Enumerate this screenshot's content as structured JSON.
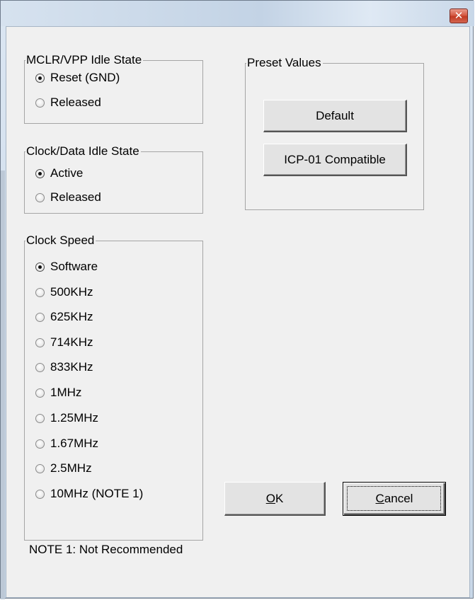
{
  "window": {
    "close_glyph": "✕"
  },
  "mclr_group": {
    "label": "MCLR/VPP Idle State",
    "options": [
      {
        "label": "Reset (GND)",
        "checked": true
      },
      {
        "label": "Released",
        "checked": false
      }
    ]
  },
  "clock_data_group": {
    "label": "Clock/Data Idle State",
    "options": [
      {
        "label": "Active",
        "checked": true
      },
      {
        "label": "Released",
        "checked": false
      }
    ]
  },
  "clock_speed_group": {
    "label": "Clock Speed",
    "options": [
      {
        "label": "Software",
        "checked": true
      },
      {
        "label": "500KHz",
        "checked": false
      },
      {
        "label": "625KHz",
        "checked": false
      },
      {
        "label": "714KHz",
        "checked": false
      },
      {
        "label": "833KHz",
        "checked": false
      },
      {
        "label": "1MHz",
        "checked": false
      },
      {
        "label": "1.25MHz",
        "checked": false
      },
      {
        "label": "1.67MHz",
        "checked": false
      },
      {
        "label": "2.5MHz",
        "checked": false
      },
      {
        "label": "10MHz (NOTE 1)",
        "checked": false
      }
    ]
  },
  "preset_group": {
    "label": "Preset Values",
    "default_label": "Default",
    "icp_label": "ICP-01 Compatible"
  },
  "buttons": {
    "ok_mnemonic": "O",
    "ok_rest": "K",
    "cancel_mnemonic": "C",
    "cancel_rest": "ancel"
  },
  "note": "NOTE 1: Not Recommended"
}
